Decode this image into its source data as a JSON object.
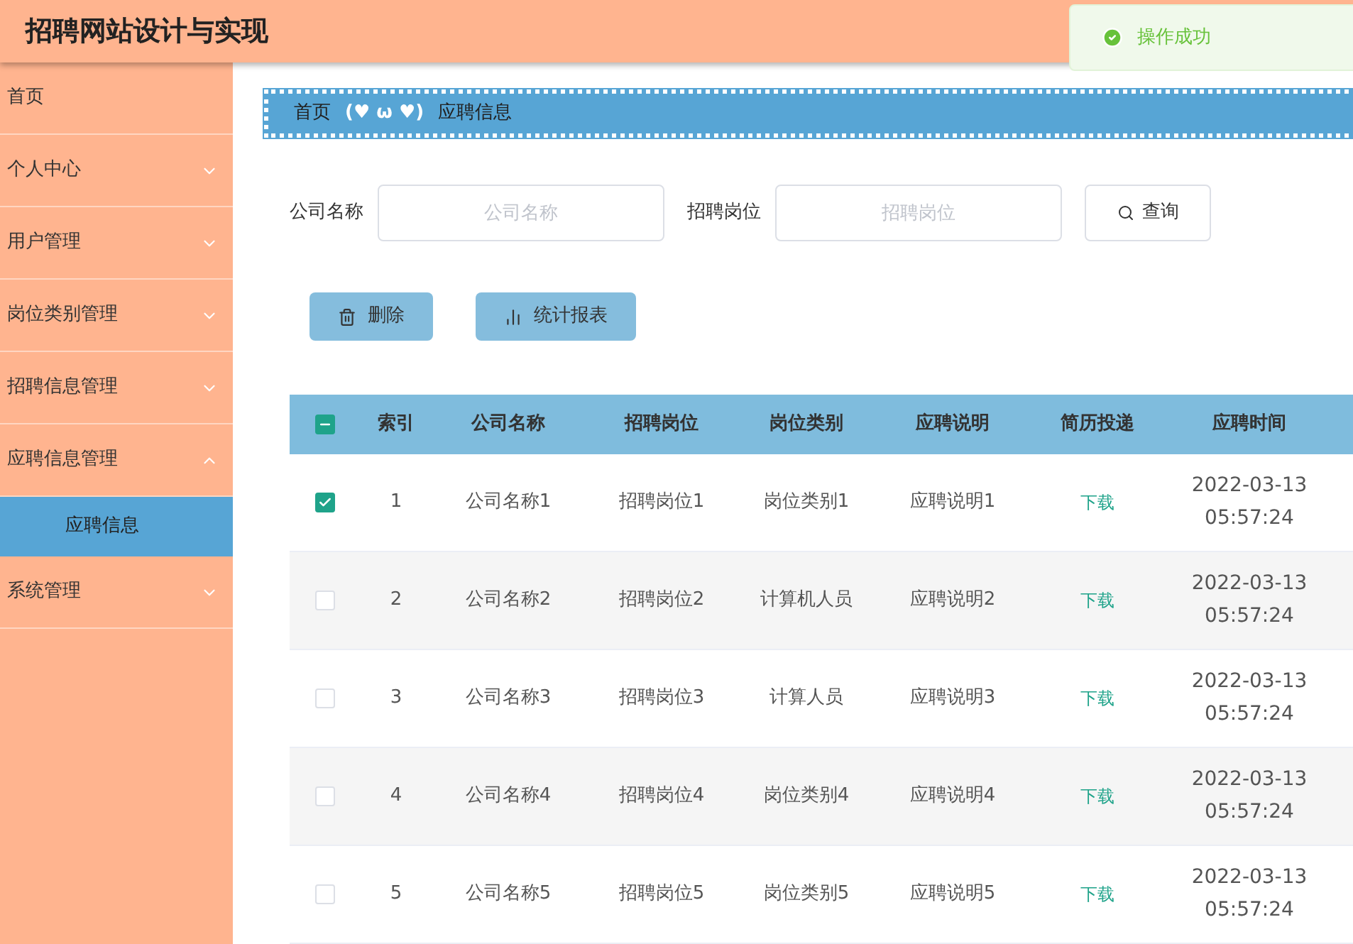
{
  "header": {
    "title": "招聘网站设计与实现"
  },
  "toast": {
    "message": "操作成功",
    "kind": "success"
  },
  "sidebar": {
    "items": [
      {
        "label": "首页",
        "kind": "link"
      },
      {
        "label": "个人中心",
        "kind": "submenu",
        "expanded": false
      },
      {
        "label": "用户管理",
        "kind": "submenu",
        "expanded": false
      },
      {
        "label": "岗位类别管理",
        "kind": "submenu",
        "expanded": false
      },
      {
        "label": "招聘信息管理",
        "kind": "submenu",
        "expanded": false
      },
      {
        "label": "应聘信息管理",
        "kind": "submenu",
        "expanded": true,
        "children": [
          {
            "label": "应聘信息",
            "selected": true
          }
        ]
      },
      {
        "label": "系统管理",
        "kind": "submenu",
        "expanded": false
      }
    ]
  },
  "breadcrumb": {
    "home": "首页",
    "separator": "(♥ ω ♥)",
    "current": "应聘信息"
  },
  "search": {
    "fields": [
      {
        "label": "公司名称",
        "placeholder": "公司名称"
      },
      {
        "label": "招聘岗位",
        "placeholder": "招聘岗位"
      }
    ],
    "button": "查询"
  },
  "actions": [
    {
      "label": "删除",
      "kind": "delete"
    },
    {
      "label": "统计报表",
      "kind": "chart"
    }
  ],
  "table": {
    "select_all": {
      "indeterminate": true
    },
    "columns": [
      "索引",
      "公司名称",
      "招聘岗位",
      "岗位类别",
      "应聘说明",
      "简历投递",
      "应聘时间"
    ],
    "rows": [
      {
        "checked": true,
        "cells": [
          "1",
          "公司名称1",
          "招聘岗位1",
          "岗位类别1",
          "应聘说明1",
          "下载",
          "2022-03-13 05:57:24"
        ]
      },
      {
        "checked": false,
        "cells": [
          "2",
          "公司名称2",
          "招聘岗位2",
          "计算机人员",
          "应聘说明2",
          "下载",
          "2022-03-13 05:57:24"
        ]
      },
      {
        "checked": false,
        "cells": [
          "3",
          "公司名称3",
          "招聘岗位3",
          "计算人员",
          "应聘说明3",
          "下载",
          "2022-03-13 05:57:24"
        ]
      },
      {
        "checked": false,
        "cells": [
          "4",
          "公司名称4",
          "招聘岗位4",
          "岗位类别4",
          "应聘说明4",
          "下载",
          "2022-03-13 05:57:24"
        ]
      },
      {
        "checked": false,
        "cells": [
          "5",
          "公司名称5",
          "招聘岗位5",
          "岗位类别5",
          "应聘说明5",
          "下载",
          "2022-03-13 05:57:24"
        ]
      }
    ]
  }
}
